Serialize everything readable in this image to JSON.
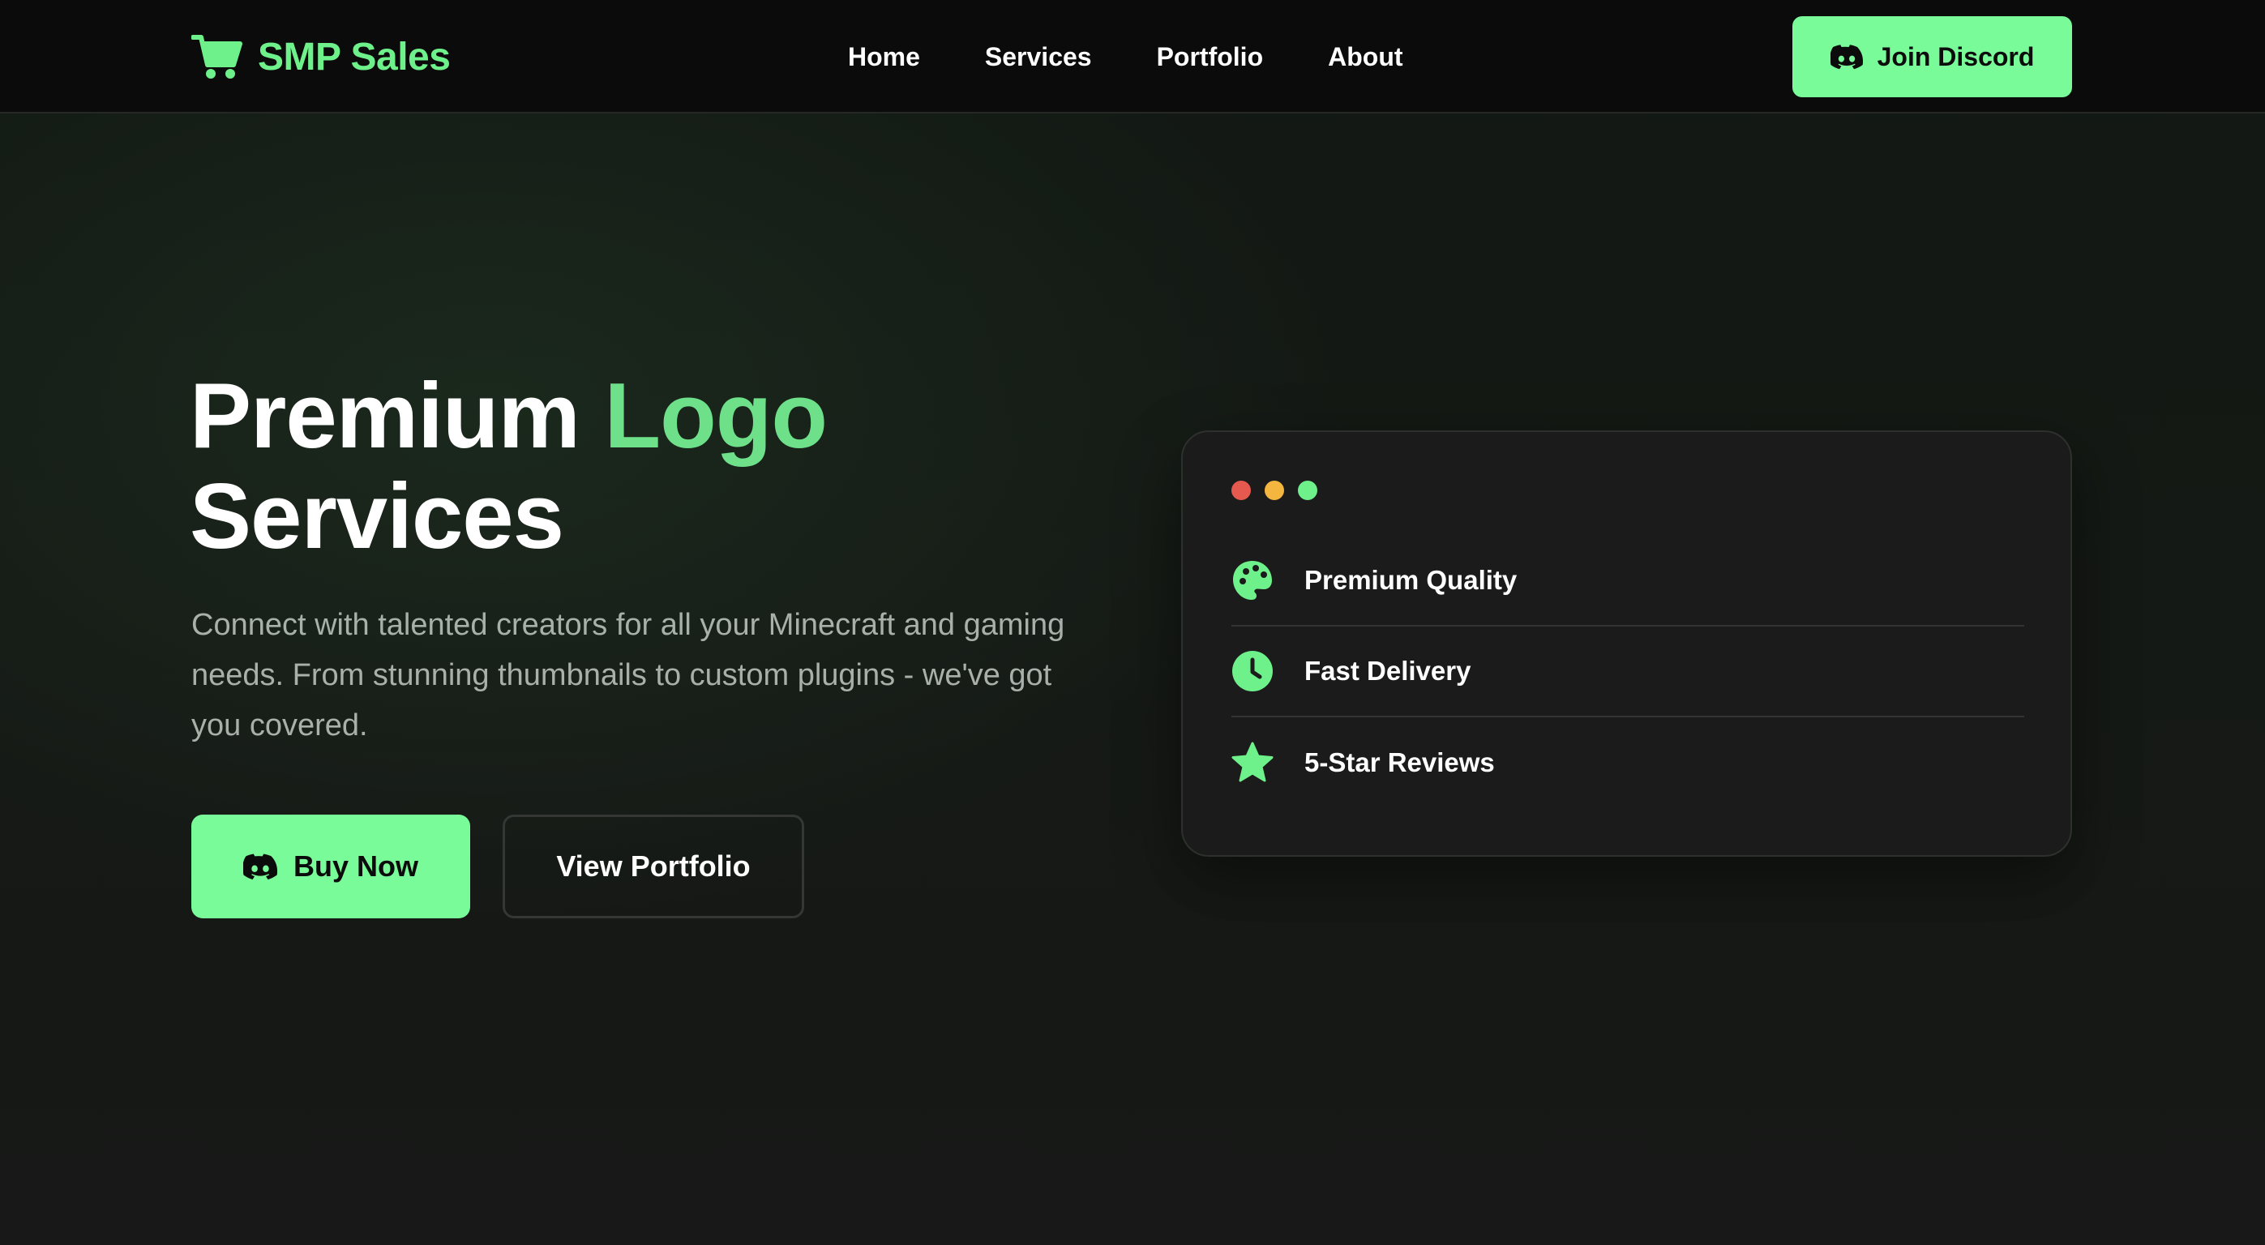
{
  "brand": {
    "name": "SMP Sales",
    "icon": "shopping-cart-icon",
    "color": "#6ef08a"
  },
  "nav": {
    "links": [
      {
        "label": "Home"
      },
      {
        "label": "Services"
      },
      {
        "label": "Portfolio"
      },
      {
        "label": "About"
      }
    ],
    "cta": {
      "label": "Join Discord",
      "icon": "discord-icon"
    }
  },
  "hero": {
    "title_part1": "Premium ",
    "title_accent": "Logo",
    "title_part2": "Services",
    "description": "Connect with talented creators for all your Minecraft and gaming needs. From stunning thumbnails to custom plugins - we've got you covered.",
    "buy_button": {
      "label": "Buy Now",
      "icon": "discord-icon"
    },
    "portfolio_button": {
      "label": "View Portfolio"
    }
  },
  "card": {
    "window_dots": [
      "#e5594f",
      "#f4b63f",
      "#6ef08a"
    ],
    "features": [
      {
        "label": "Premium Quality",
        "icon": "palette-icon"
      },
      {
        "label": "Fast Delivery",
        "icon": "clock-icon"
      },
      {
        "label": "5-Star Reviews",
        "icon": "star-icon"
      }
    ]
  },
  "colors": {
    "accent": "#78fb98",
    "background": "#141714",
    "nav_background": "#0b0b0b",
    "card_background": "#1b1b1b"
  }
}
